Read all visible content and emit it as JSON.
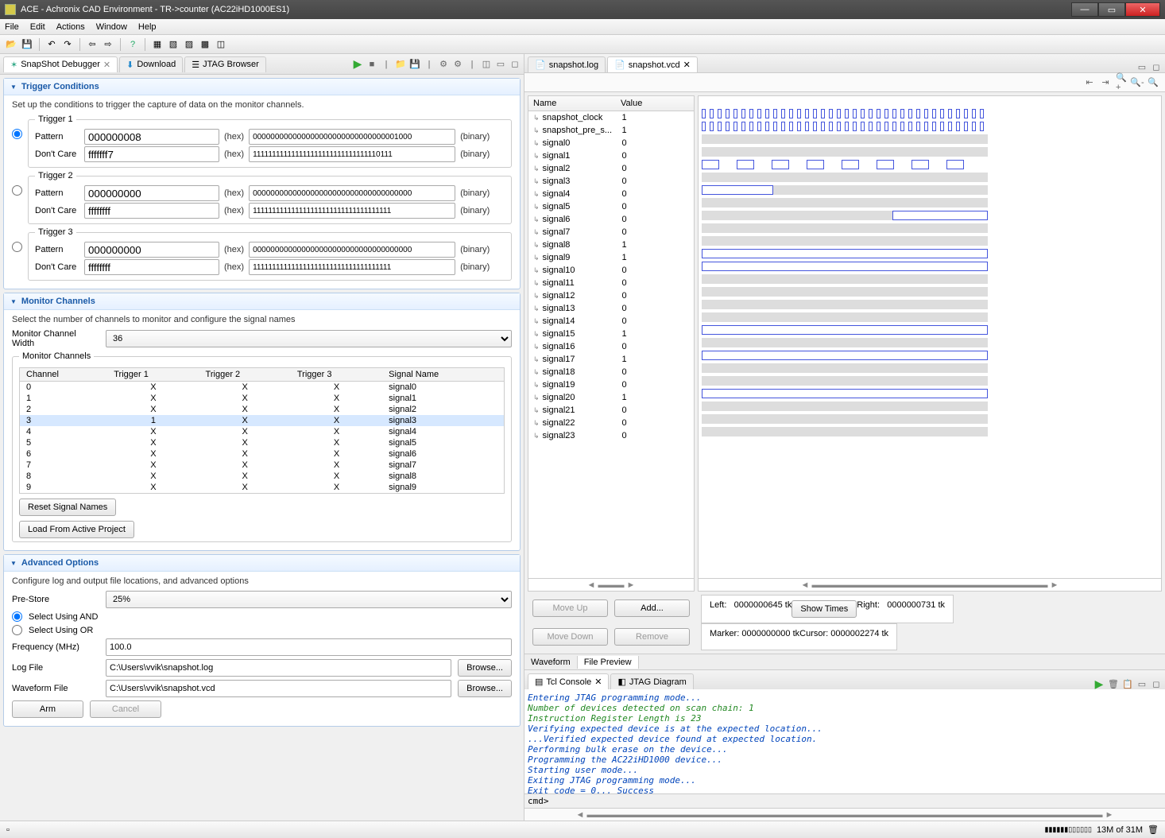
{
  "window": {
    "title": "ACE - Achronix CAD Environment - TR->counter (AC22iHD1000ES1)"
  },
  "menu": [
    "File",
    "Edit",
    "Actions",
    "Window",
    "Help"
  ],
  "left_panel": {
    "tabs": {
      "debugger": "SnapShot Debugger",
      "download": "Download",
      "jtag": "JTAG Browser"
    }
  },
  "trigger_conditions": {
    "title": "Trigger Conditions",
    "desc": "Set up the conditions to trigger the capture of data on the monitor channels.",
    "triggers": [
      {
        "legend": "Trigger 1",
        "selected": true,
        "pattern_hex": "000000008",
        "pattern_bin": "000000000000000000000000000000001000",
        "dontcare_hex": "fffffff7",
        "dontcare_bin": "111111111111111111111111111111110111"
      },
      {
        "legend": "Trigger 2",
        "selected": false,
        "pattern_hex": "000000000",
        "pattern_bin": "000000000000000000000000000000000000",
        "dontcare_hex": "ffffffff",
        "dontcare_bin": "111111111111111111111111111111111111"
      },
      {
        "legend": "Trigger 3",
        "selected": false,
        "pattern_hex": "000000000",
        "pattern_bin": "000000000000000000000000000000000000",
        "dontcare_hex": "ffffffff",
        "dontcare_bin": "111111111111111111111111111111111111"
      }
    ],
    "labels": {
      "pattern": "Pattern",
      "dontcare": "Don't Care",
      "hex": "(hex)",
      "binary": "(binary)"
    }
  },
  "monitor_channels": {
    "title": "Monitor Channels",
    "desc": "Select the number of channels to monitor and configure the signal names",
    "width_label": "Monitor Channel Width",
    "width": "36",
    "fieldset_label": "Monitor Channels",
    "cols": [
      "Channel",
      "Trigger 1",
      "Trigger 2",
      "Trigger 3",
      "Signal Name"
    ],
    "rows": [
      {
        "ch": "0",
        "t1": "X",
        "t2": "X",
        "t3": "X",
        "name": "signal0",
        "sel": false
      },
      {
        "ch": "1",
        "t1": "X",
        "t2": "X",
        "t3": "X",
        "name": "signal1",
        "sel": false
      },
      {
        "ch": "2",
        "t1": "X",
        "t2": "X",
        "t3": "X",
        "name": "signal2",
        "sel": false
      },
      {
        "ch": "3",
        "t1": "1",
        "t2": "X",
        "t3": "X",
        "name": "signal3",
        "sel": true
      },
      {
        "ch": "4",
        "t1": "X",
        "t2": "X",
        "t3": "X",
        "name": "signal4",
        "sel": false
      },
      {
        "ch": "5",
        "t1": "X",
        "t2": "X",
        "t3": "X",
        "name": "signal5",
        "sel": false
      },
      {
        "ch": "6",
        "t1": "X",
        "t2": "X",
        "t3": "X",
        "name": "signal6",
        "sel": false
      },
      {
        "ch": "7",
        "t1": "X",
        "t2": "X",
        "t3": "X",
        "name": "signal7",
        "sel": false
      },
      {
        "ch": "8",
        "t1": "X",
        "t2": "X",
        "t3": "X",
        "name": "signal8",
        "sel": false
      },
      {
        "ch": "9",
        "t1": "X",
        "t2": "X",
        "t3": "X",
        "name": "signal9",
        "sel": false
      }
    ],
    "reset_btn": "Reset Signal Names",
    "load_btn": "Load From Active Project"
  },
  "advanced": {
    "title": "Advanced Options",
    "desc": "Configure log and output file locations, and advanced options",
    "prestore_label": "Pre-Store",
    "prestore": "25%",
    "and_label": "Select Using AND",
    "or_label": "Select Using OR",
    "freq_label": "Frequency (MHz)",
    "freq": "100.0",
    "log_label": "Log File",
    "log": "C:\\Users\\vvik\\snapshot.log",
    "wave_label": "Waveform File",
    "wave": "C:\\Users\\vvik\\snapshot.vcd",
    "browse": "Browse...",
    "arm": "Arm",
    "cancel": "Cancel"
  },
  "editor": {
    "tabs": [
      "snapshot.log",
      "snapshot.vcd"
    ],
    "active": 1,
    "signal_cols": {
      "name": "Name",
      "value": "Value"
    },
    "signals": [
      {
        "name": "snapshot_clock",
        "value": "1"
      },
      {
        "name": "snapshot_pre_s...",
        "value": "1"
      },
      {
        "name": "signal0",
        "value": "0"
      },
      {
        "name": "signal1",
        "value": "0"
      },
      {
        "name": "signal2",
        "value": "0"
      },
      {
        "name": "signal3",
        "value": "0"
      },
      {
        "name": "signal4",
        "value": "0"
      },
      {
        "name": "signal5",
        "value": "0"
      },
      {
        "name": "signal6",
        "value": "0"
      },
      {
        "name": "signal7",
        "value": "0"
      },
      {
        "name": "signal8",
        "value": "1"
      },
      {
        "name": "signal9",
        "value": "1"
      },
      {
        "name": "signal10",
        "value": "0"
      },
      {
        "name": "signal11",
        "value": "0"
      },
      {
        "name": "signal12",
        "value": "0"
      },
      {
        "name": "signal13",
        "value": "0"
      },
      {
        "name": "signal14",
        "value": "0"
      },
      {
        "name": "signal15",
        "value": "1"
      },
      {
        "name": "signal16",
        "value": "0"
      },
      {
        "name": "signal17",
        "value": "1"
      },
      {
        "name": "signal18",
        "value": "0"
      },
      {
        "name": "signal19",
        "value": "0"
      },
      {
        "name": "signal20",
        "value": "1"
      },
      {
        "name": "signal21",
        "value": "0"
      },
      {
        "name": "signal22",
        "value": "0"
      },
      {
        "name": "signal23",
        "value": "0"
      }
    ],
    "moveup": "Move Up",
    "movedown": "Move Down",
    "add": "Add...",
    "remove": "Remove",
    "show_times": "Show Times",
    "left_label": "Left:",
    "left_val": "0000000645 tk",
    "right_label": "Right:",
    "right_val": "0000000731 tk",
    "marker_label": "Marker:",
    "marker_val": "0000000000 tk",
    "cursor_label": "Cursor:",
    "cursor_val": "0000002274 tk",
    "bottom_tabs": [
      "Waveform",
      "File Preview"
    ]
  },
  "console": {
    "tabs": {
      "tcl": "Tcl Console",
      "jtag": "JTAG Diagram"
    },
    "lines": [
      "Entering JTAG programming mode...",
      "Number of devices detected on scan chain: 1",
      "  Instruction Register Length is 23",
      "Verifying expected device is at the expected location...",
      "...Verified expected device found at expected location.",
      "Performing bulk erase on the device...",
      "Programming the AC22iHD1000 device...",
      "Starting user mode...",
      "Exiting JTAG programming mode...",
      "Exit code = 0... Success"
    ],
    "prompt": "cmd>"
  },
  "status": {
    "mem": "13M of 31M"
  }
}
